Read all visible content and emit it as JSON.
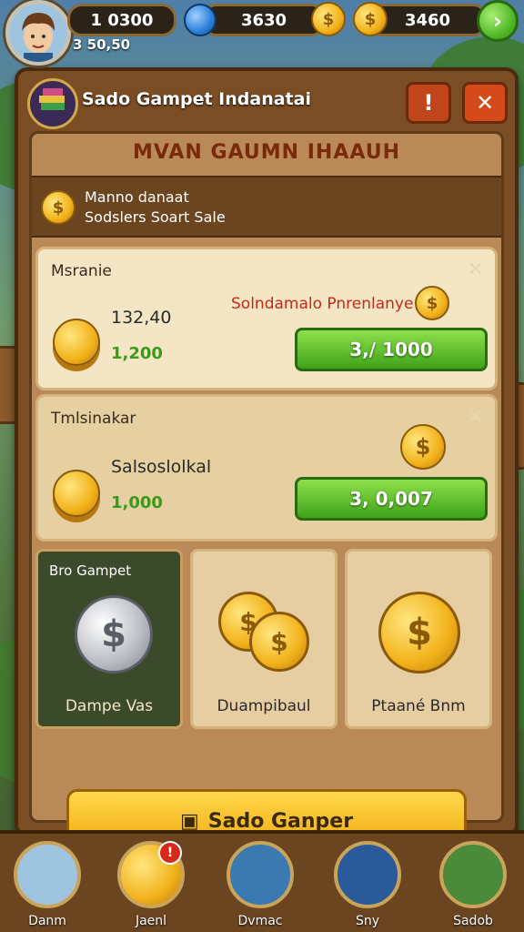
{
  "hud": {
    "primary_count": "1 0300",
    "secondary_count": "3 50,50",
    "gems_count": "3630",
    "coins_count": "3460",
    "gem_icon": "gem-icon",
    "coin_icon": "coin-icon",
    "next_icon": "arrow-right-icon",
    "coin_symbol": "$",
    "next_symbol": "›"
  },
  "panel": {
    "title": "Sado Gampet Indanatai",
    "banner": "MVAN GAUMN IHAAUH",
    "info_label": "!",
    "close_label": "✕",
    "sub_line1": "Manno danaat",
    "sub_line2": "Sodslers Soart Sale"
  },
  "offers": [
    {
      "title": "Msranie",
      "amount_a": "132,40",
      "amount_b": "1,200",
      "promo": "Solndamalo Pnrenlanye",
      "price": "3,/ 1000"
    },
    {
      "title": "Tmlsinakar",
      "amount_a": "Salsoslolkal",
      "amount_b": "1,000",
      "price": "3, 0,007"
    }
  ],
  "tiles": [
    {
      "badge": "Bro Gampet",
      "label": "Dampe Vas"
    },
    {
      "label": "Duampibaul"
    },
    {
      "label": "Ptaané Bnm"
    }
  ],
  "cta": {
    "label": "Sado Ganper"
  },
  "nav": [
    {
      "label": "Danm"
    },
    {
      "label": "Jaenl",
      "badge": "!"
    },
    {
      "label": "Dvmac"
    },
    {
      "label": "Sny"
    },
    {
      "label": "Sadob"
    }
  ],
  "colors": {
    "panel_wood": "#7a4d24",
    "buy_green": "#46b020",
    "cta_yellow": "#ffd84a",
    "promo_red": "#c42a1a"
  }
}
